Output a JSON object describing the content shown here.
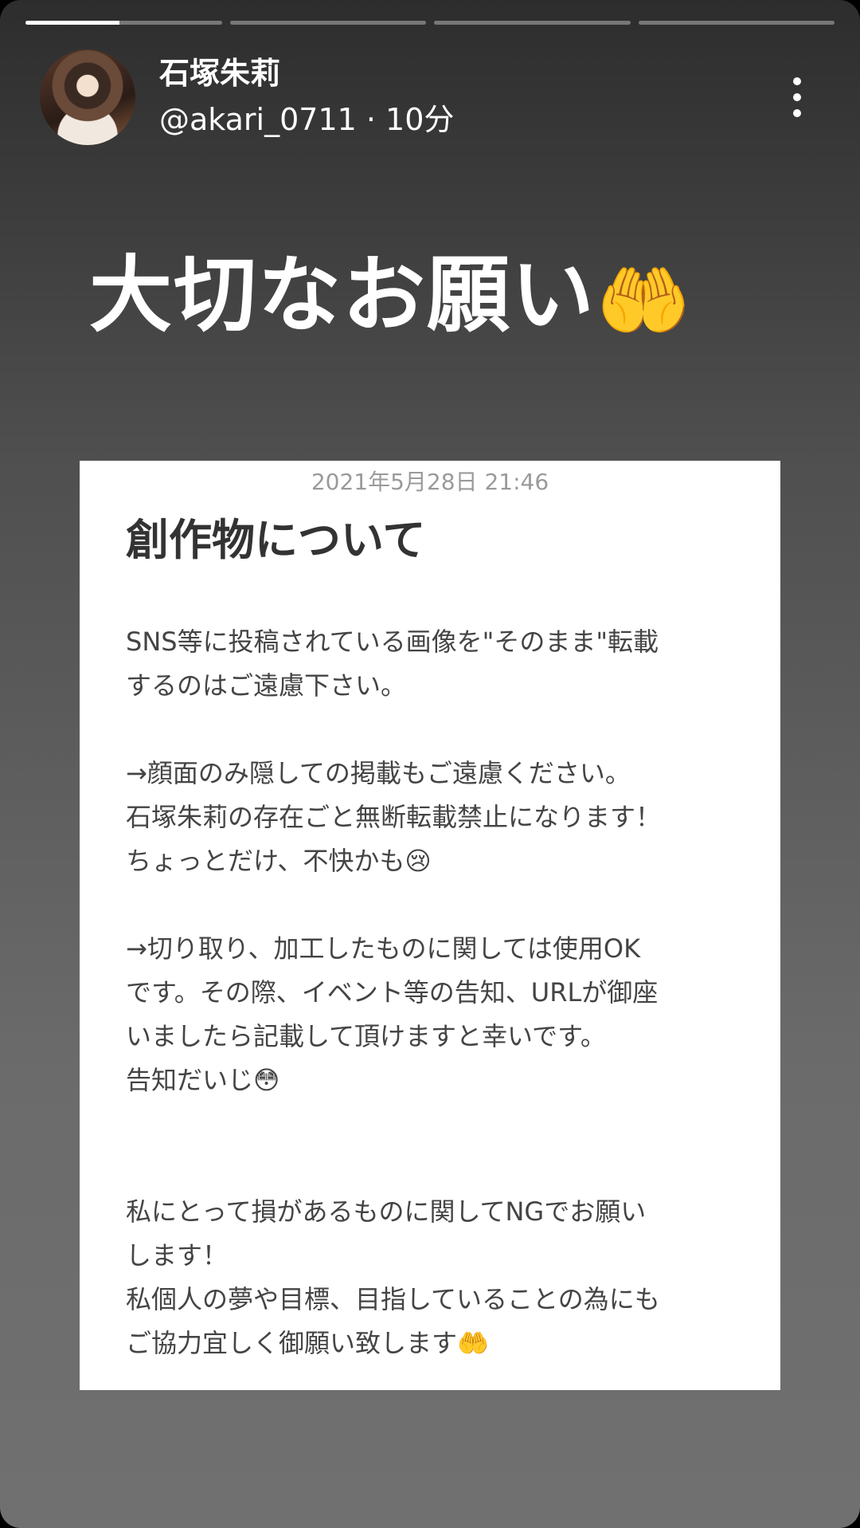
{
  "progress": {
    "segments": 4,
    "current_fill": 0.48
  },
  "header": {
    "username": "石塚朱莉",
    "handle_time": "@akari_0711 · 10分",
    "more_icon": "more-vertical-icon"
  },
  "headline": {
    "text": "大切なお願い",
    "emoji": "🤲"
  },
  "card": {
    "date": "2021年5月28日 21:46",
    "title": "創作物について",
    "lines": [
      "SNS等に投稿されている画像を\"そのまま\"転載",
      "するのはご遠慮下さい。",
      "",
      "→顔面のみ隠しての掲載もご遠慮ください。",
      "石塚朱莉の存在ごと無断転載禁止になります！",
      "ちょっとだけ、不快かも😢",
      "",
      "→切り取り、加工したものに関しては使用OK",
      "です。その際、イベント等の告知、URLが御座",
      "いましたら記載して頂けますと幸いです。",
      "告知だいじ😳",
      "",
      "",
      "私にとって損があるものに関してNGでお願い",
      "します！",
      "私個人の夢や目標、目指していることの為にも",
      "ご協力宜しく御願い致します🤲"
    ]
  }
}
